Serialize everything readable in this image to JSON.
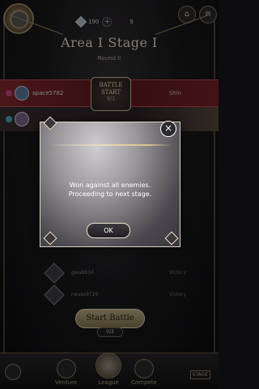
{
  "header": {
    "currency_a": "190",
    "currency_b": "9",
    "stage_title": "Area I Stage I",
    "round_label": "Round II"
  },
  "opponents": {
    "top_player": {
      "name": "space5782",
      "status": "Shin"
    },
    "battle_medal": {
      "line1": "BATTLE",
      "line2": "START",
      "count": "0/3"
    }
  },
  "list": [
    {
      "name": "gwa8834",
      "result": "Victory"
    },
    {
      "name": "neuse9729",
      "result": "Victory"
    }
  ],
  "start_battle": {
    "label": "Start Battle",
    "count": "0/3"
  },
  "nav": {
    "items": [
      "Venture",
      "League",
      "Compete"
    ],
    "right_tag": "STAGE"
  },
  "modal": {
    "line1": "Won against all enemies.",
    "line2": "Proceeding to next stage.",
    "ok_label": "OK"
  },
  "colors": {
    "accent_red": "#8a2a30",
    "gold": "#c6b58d"
  }
}
